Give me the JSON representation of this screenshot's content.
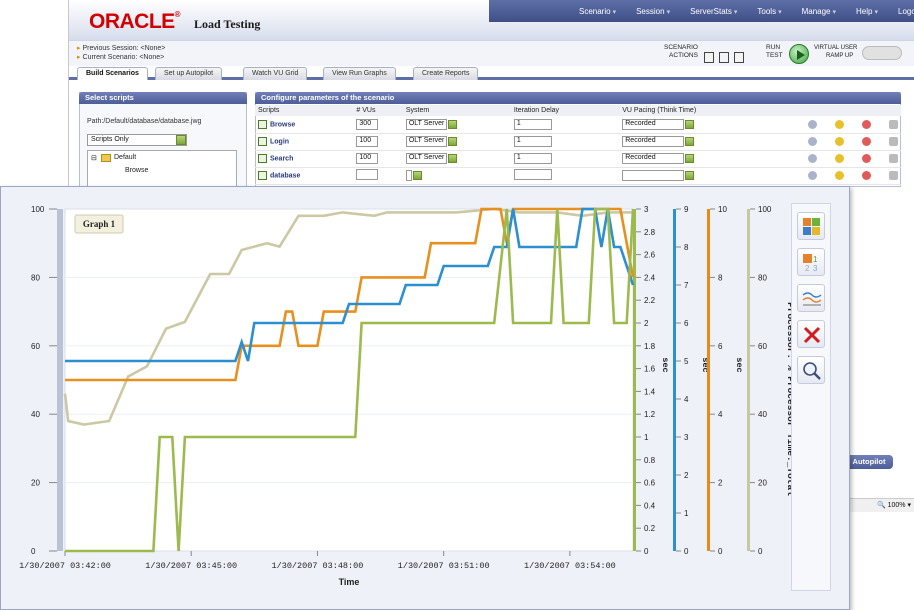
{
  "app": {
    "logo": "ORACLE",
    "logo_mark": "®",
    "title": "Load Testing"
  },
  "menu": [
    {
      "label": "Scenario",
      "caret": "▾"
    },
    {
      "label": "Session",
      "caret": "▾"
    },
    {
      "label": "ServerStats",
      "caret": "▾"
    },
    {
      "label": "Tools",
      "caret": "▾"
    },
    {
      "label": "Manage",
      "caret": "▾"
    },
    {
      "label": "Help",
      "caret": "▾"
    },
    {
      "label": "Logout",
      "caret": ""
    }
  ],
  "session": {
    "previous": "Previous Session: <None>",
    "current": "Current Scenario: <None>"
  },
  "toolbar": {
    "scenario_actions_1": "SCENARIO",
    "scenario_actions_2": "ACTIONS",
    "run_test_1": "RUN",
    "run_test_2": "TEST",
    "vu_ramp_1": "VIRTUAL USER",
    "vu_ramp_2": "RAMP UP"
  },
  "tabs": [
    {
      "label": "Build Scenarios",
      "active": true
    },
    {
      "label": "Set up Autopilot",
      "active": false
    },
    {
      "label": "Watch VU Grid",
      "active": false
    },
    {
      "label": "View Run Graphs",
      "active": false
    },
    {
      "label": "Create Reports",
      "active": false
    }
  ],
  "select_scripts": {
    "heading": "Select scripts",
    "path": "Path:/Default/database/database.jwg",
    "filter_value": "Scripts Only",
    "tree_root": "Default",
    "tree_child": "Browse"
  },
  "config": {
    "heading": "Configure parameters of the scenario",
    "columns": [
      "Scripts",
      "# VUs",
      "System",
      "Iteration Delay",
      "VU Pacing (Think Time)"
    ],
    "rows": [
      {
        "script": "Browse",
        "vus": "300",
        "system": "OLT Server",
        "delay": "1",
        "pacing": "Recorded"
      },
      {
        "script": "Login",
        "vus": "100",
        "system": "OLT Server",
        "delay": "1",
        "pacing": "Recorded"
      },
      {
        "script": "Search",
        "vus": "100",
        "system": "OLT Server",
        "delay": "1",
        "pacing": "Recorded"
      },
      {
        "script": "database",
        "vus": "",
        "system": "",
        "delay": "",
        "pacing": ""
      }
    ]
  },
  "autopilot_button": "Autopilot",
  "zoom_level": "100%",
  "graph": {
    "name": "Graph 1",
    "toolbar_icons": [
      "layout-icon",
      "counter-select-icon",
      "line-style-icon",
      "delete-icon",
      "zoom-icon"
    ]
  },
  "chart_data": {
    "type": "line",
    "title": "",
    "xlabel": "Time",
    "x_ticks": [
      "1/30/2007 03:42:00",
      "1/30/2007 03:45:00",
      "1/30/2007 03:48:00",
      "1/30/2007 03:51:00",
      "1/30/2007 03:54:00"
    ],
    "x": [
      0,
      1,
      2,
      3,
      4,
      5,
      6,
      7,
      8,
      9,
      10,
      11,
      12,
      13,
      14,
      15,
      16,
      17,
      18,
      19,
      20,
      21,
      22,
      23,
      24,
      25,
      26,
      27,
      28,
      29,
      30,
      31,
      32,
      33,
      34,
      35,
      36,
      37,
      38,
      39,
      40,
      41,
      42,
      43,
      44,
      45,
      46,
      47,
      48,
      49,
      50,
      51,
      52,
      53,
      54,
      55,
      56,
      57,
      58,
      59,
      60,
      61,
      62,
      63,
      64,
      65,
      66,
      67,
      68,
      69,
      70,
      71,
      72,
      73,
      74,
      75,
      76,
      77,
      78,
      79,
      80,
      81,
      82,
      83,
      84,
      85,
      86,
      87,
      88,
      89,
      90
    ],
    "axes": [
      {
        "side": "left",
        "label": "",
        "min": 0,
        "max": 100,
        "ticks": [
          0,
          20,
          40,
          60,
          80,
          100
        ],
        "color": "#b8c4d6"
      },
      {
        "side": "right",
        "label": "sec",
        "min": 0,
        "max": 3,
        "ticks": [
          0,
          0.2,
          0.4,
          0.6,
          0.8,
          1,
          1.2,
          1.4,
          1.6,
          1.8,
          2,
          2.2,
          2.4,
          2.6,
          2.8,
          3
        ],
        "color": "#9cba4e"
      },
      {
        "side": "right",
        "label": "sec",
        "min": 0,
        "max": 9,
        "ticks": [
          0,
          1,
          2,
          3,
          4,
          5,
          6,
          7,
          8,
          9
        ],
        "color": "#2b8fd0"
      },
      {
        "side": "right",
        "label": "sec",
        "min": 0,
        "max": 10,
        "ticks": [
          0,
          2,
          4,
          6,
          8,
          10
        ],
        "color": "#e58b1a"
      },
      {
        "side": "right",
        "label": "Processor: % Processor Time:_Total",
        "min": 0,
        "max": 100,
        "ticks": [
          0,
          20,
          40,
          60,
          80,
          100
        ],
        "color": "#c8c8a0"
      }
    ],
    "series": [
      {
        "axis": 4,
        "color": "#cdc8a4",
        "points": [
          [
            0,
            46
          ],
          [
            0.5,
            38
          ],
          [
            3,
            37
          ],
          [
            7,
            38
          ],
          [
            10,
            51
          ],
          [
            13,
            54
          ],
          [
            16,
            65
          ],
          [
            19,
            67
          ],
          [
            23,
            81
          ],
          [
            26,
            81
          ],
          [
            28,
            88
          ],
          [
            32,
            90
          ],
          [
            34,
            89
          ],
          [
            37,
            98
          ],
          [
            41,
            98
          ],
          [
            44,
            99
          ],
          [
            49,
            98
          ],
          [
            51,
            99
          ],
          [
            53,
            99
          ],
          [
            56,
            99
          ],
          [
            58,
            99
          ],
          [
            62,
            99
          ],
          [
            68,
            100
          ],
          [
            72,
            99
          ],
          [
            78,
            99
          ],
          [
            82,
            98
          ],
          [
            86,
            99
          ],
          [
            88,
            99
          ],
          [
            90,
            99
          ]
        ]
      },
      {
        "axis": 3,
        "color": "#e8901f",
        "points": [
          [
            0,
            5
          ],
          [
            27,
            5
          ],
          [
            28,
            6
          ],
          [
            30,
            6
          ],
          [
            34,
            6
          ],
          [
            35,
            7
          ],
          [
            36,
            7
          ],
          [
            37,
            6
          ],
          [
            40,
            6
          ],
          [
            41,
            7
          ],
          [
            45,
            7
          ],
          [
            46,
            7
          ],
          [
            47,
            8
          ],
          [
            55,
            8
          ],
          [
            56,
            8
          ],
          [
            57,
            8
          ],
          [
            58,
            9
          ],
          [
            61,
            9
          ],
          [
            62,
            9
          ],
          [
            63,
            9
          ],
          [
            65,
            9
          ],
          [
            66,
            10
          ],
          [
            69,
            10
          ],
          [
            70,
            9
          ],
          [
            71,
            10
          ],
          [
            88,
            10
          ],
          [
            89,
            9
          ],
          [
            90,
            8
          ]
        ]
      },
      {
        "axis": 2,
        "color": "#2b8fd0",
        "points": [
          [
            0,
            5
          ],
          [
            27,
            5
          ],
          [
            28,
            5.5
          ],
          [
            29,
            5
          ],
          [
            30,
            6
          ],
          [
            33,
            6
          ],
          [
            34,
            6
          ],
          [
            44,
            6
          ],
          [
            45,
            6.5
          ],
          [
            53,
            6.5
          ],
          [
            54,
            7
          ],
          [
            59,
            7
          ],
          [
            60,
            7.5
          ],
          [
            67,
            7.5
          ],
          [
            68,
            8
          ],
          [
            70,
            8
          ],
          [
            71,
            9
          ],
          [
            72,
            8
          ],
          [
            81,
            8
          ],
          [
            82,
            9
          ],
          [
            84,
            9
          ],
          [
            85,
            8
          ],
          [
            86,
            9
          ],
          [
            87,
            8
          ],
          [
            88,
            8
          ],
          [
            89,
            7.5
          ],
          [
            90,
            7
          ]
        ]
      },
      {
        "axis": 1,
        "color": "#9cba4e",
        "points": [
          [
            0,
            0
          ],
          [
            14,
            0
          ],
          [
            15,
            1
          ],
          [
            17,
            1
          ],
          [
            18,
            0
          ],
          [
            19,
            1
          ],
          [
            28,
            1
          ],
          [
            46,
            1
          ],
          [
            47,
            2
          ],
          [
            59,
            2
          ],
          [
            67,
            2
          ],
          [
            68,
            2
          ],
          [
            70,
            3
          ],
          [
            71,
            2
          ],
          [
            77,
            2
          ],
          [
            78,
            3
          ],
          [
            79,
            2
          ],
          [
            83,
            2
          ],
          [
            84,
            3
          ],
          [
            86,
            3
          ],
          [
            87,
            2
          ],
          [
            89,
            2
          ],
          [
            90,
            3
          ]
        ]
      }
    ]
  }
}
